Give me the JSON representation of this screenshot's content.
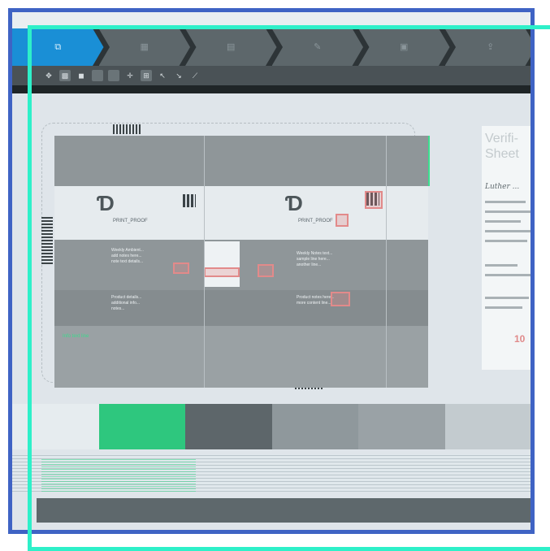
{
  "window": {
    "title": ""
  },
  "steps": [
    {
      "label": "",
      "icon": "compare-icon",
      "active": true
    },
    {
      "label": "",
      "icon": "grid-icon",
      "active": false
    },
    {
      "label": "",
      "icon": "layers-icon",
      "active": false
    },
    {
      "label": "",
      "icon": "pen-icon",
      "active": false
    },
    {
      "label": "",
      "icon": "report-icon",
      "active": false
    },
    {
      "label": "",
      "icon": "export-icon",
      "active": false
    }
  ],
  "toolbar": {
    "tools": [
      "pointer-icon",
      "image-icon",
      "image-alt-icon",
      "blank-icon",
      "blank-icon",
      "crosshair-icon",
      "zoom-icon",
      "pan-icon",
      "measure-icon",
      "dropper-icon"
    ]
  },
  "artwork": {
    "brand_name": "PRINT_PROOF",
    "left_panel_text": "Weekly Ambient...\nadd notes here...\nnote text details...",
    "right_panel_text": "Weekly Notes text...\nsample line here...\nanother line...",
    "low_left_text": "Product details...\nadditional info...\nnotes...",
    "low_right_text": "Product notes here...\nmore content line...",
    "green_label": "Info text line"
  },
  "sheet": {
    "title": "Verifi-\nSheet",
    "handwriting": "Luther ...",
    "red_value": "10"
  },
  "colors": {
    "accent": "#1a8fd6",
    "frame_blue": "#3f63c4",
    "frame_teal": "#2ef0c9",
    "diff_red": "#e28a8a",
    "diff_green": "#3ed98d",
    "swatches": [
      "#e6ecef",
      "#2ec77e",
      "#5d666a",
      "#8f989c",
      "#9aa2a6",
      "#c3cbcf"
    ]
  }
}
